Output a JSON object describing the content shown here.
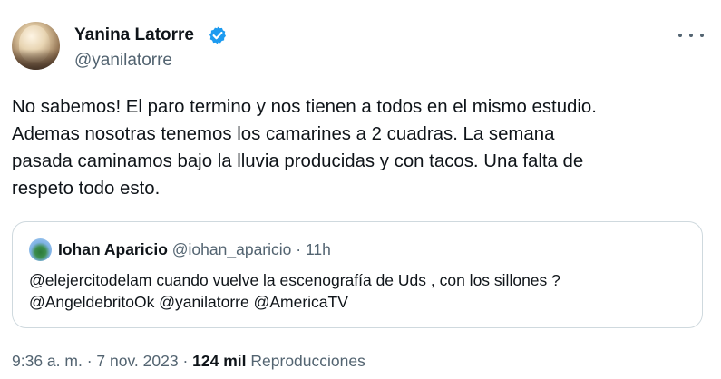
{
  "author": {
    "display_name": "Yanina Latorre",
    "handle": "@yanilatorre",
    "verified_color": "#1d9bf0"
  },
  "tweet": {
    "lines": [
      "No sabemos! El paro termino y nos tienen a todos en el mismo estudio.",
      "Ademas nosotras tenemos los camarines a 2 cuadras. La semana",
      "pasada caminamos bajo la lluvia producidas y con tacos. Una falta de",
      "respeto todo esto."
    ]
  },
  "quoted": {
    "display_name": "Iohan Aparicio",
    "handle": "@iohan_aparicio",
    "separator": "·",
    "time": "11h",
    "lines": [
      "@elejercitodelam cuando vuelve la escenografía de Uds , con los sillones ?",
      "@AngeldebritoOk @yanilatorre @AmericaTV"
    ]
  },
  "footer": {
    "time": "9:36 a. m.",
    "separator1": "·",
    "date": "7 nov. 2023",
    "separator2": "·",
    "views_count": "124 mil",
    "views_label": "Reproducciones"
  },
  "icons": {
    "more": "more-horizontal-icon",
    "verified": "verified-badge-icon"
  }
}
